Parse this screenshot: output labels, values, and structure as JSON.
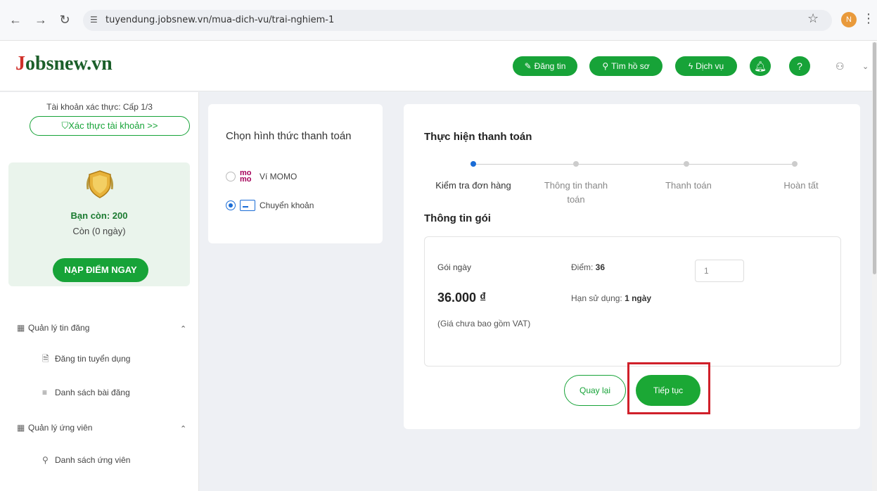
{
  "browser": {
    "url": "tuyendung.jobsnew.vn/mua-dich-vu/trai-nghiem-1",
    "profile_initial": "N"
  },
  "header": {
    "logo_first": "J",
    "logo_rest": "obsnew.vn",
    "post_job": "Đăng tin",
    "find_cv": "Tìm hồ sơ",
    "services": "Dịch vụ",
    "help": "?"
  },
  "sidebar": {
    "verify_title": "Tài khoản xác thực: Cấp 1/3",
    "verify_button": "Xác thực tài khoản >>",
    "credit_left": "Bạn còn: 200",
    "credit_days": "Còn (0 ngày)",
    "topup_button": "NẠP ĐIỂM NGAY",
    "groups": [
      {
        "label": "Quản lý tin đăng",
        "items": [
          "Đăng tin tuyển dụng",
          "Danh sách bài đăng"
        ]
      },
      {
        "label": "Quản lý ứng viên",
        "items": [
          "Danh sách ứng viên"
        ]
      }
    ]
  },
  "method_panel": {
    "title": "Chọn hình thức thanh toán",
    "options": [
      {
        "label": "Ví MOMO",
        "selected": false
      },
      {
        "label": "Chuyển khoản",
        "selected": true
      }
    ]
  },
  "payment": {
    "title": "Thực hiện thanh toán",
    "steps": [
      "Kiểm tra đơn hàng",
      "Thông tin thanh toán",
      "Thanh toán",
      "Hoàn tất"
    ],
    "active_step": 1,
    "package_title": "Thông tin gói",
    "package": {
      "name": "Gói ngày",
      "price": "36.000 ₫",
      "note": "(Giá chưa bao gồm VAT)",
      "points_label": "Điểm: ",
      "points_value": "36",
      "validity_label": "Hạn sử dụng: ",
      "validity_value": "1 ngày",
      "quantity": "1"
    },
    "back_button": "Quay lại",
    "continue_button": "Tiếp tục"
  },
  "colors": {
    "brand_green": "#17a338",
    "logo_red": "#d0302a",
    "highlight": "#d0202a",
    "step_active": "#1a6cd6"
  }
}
